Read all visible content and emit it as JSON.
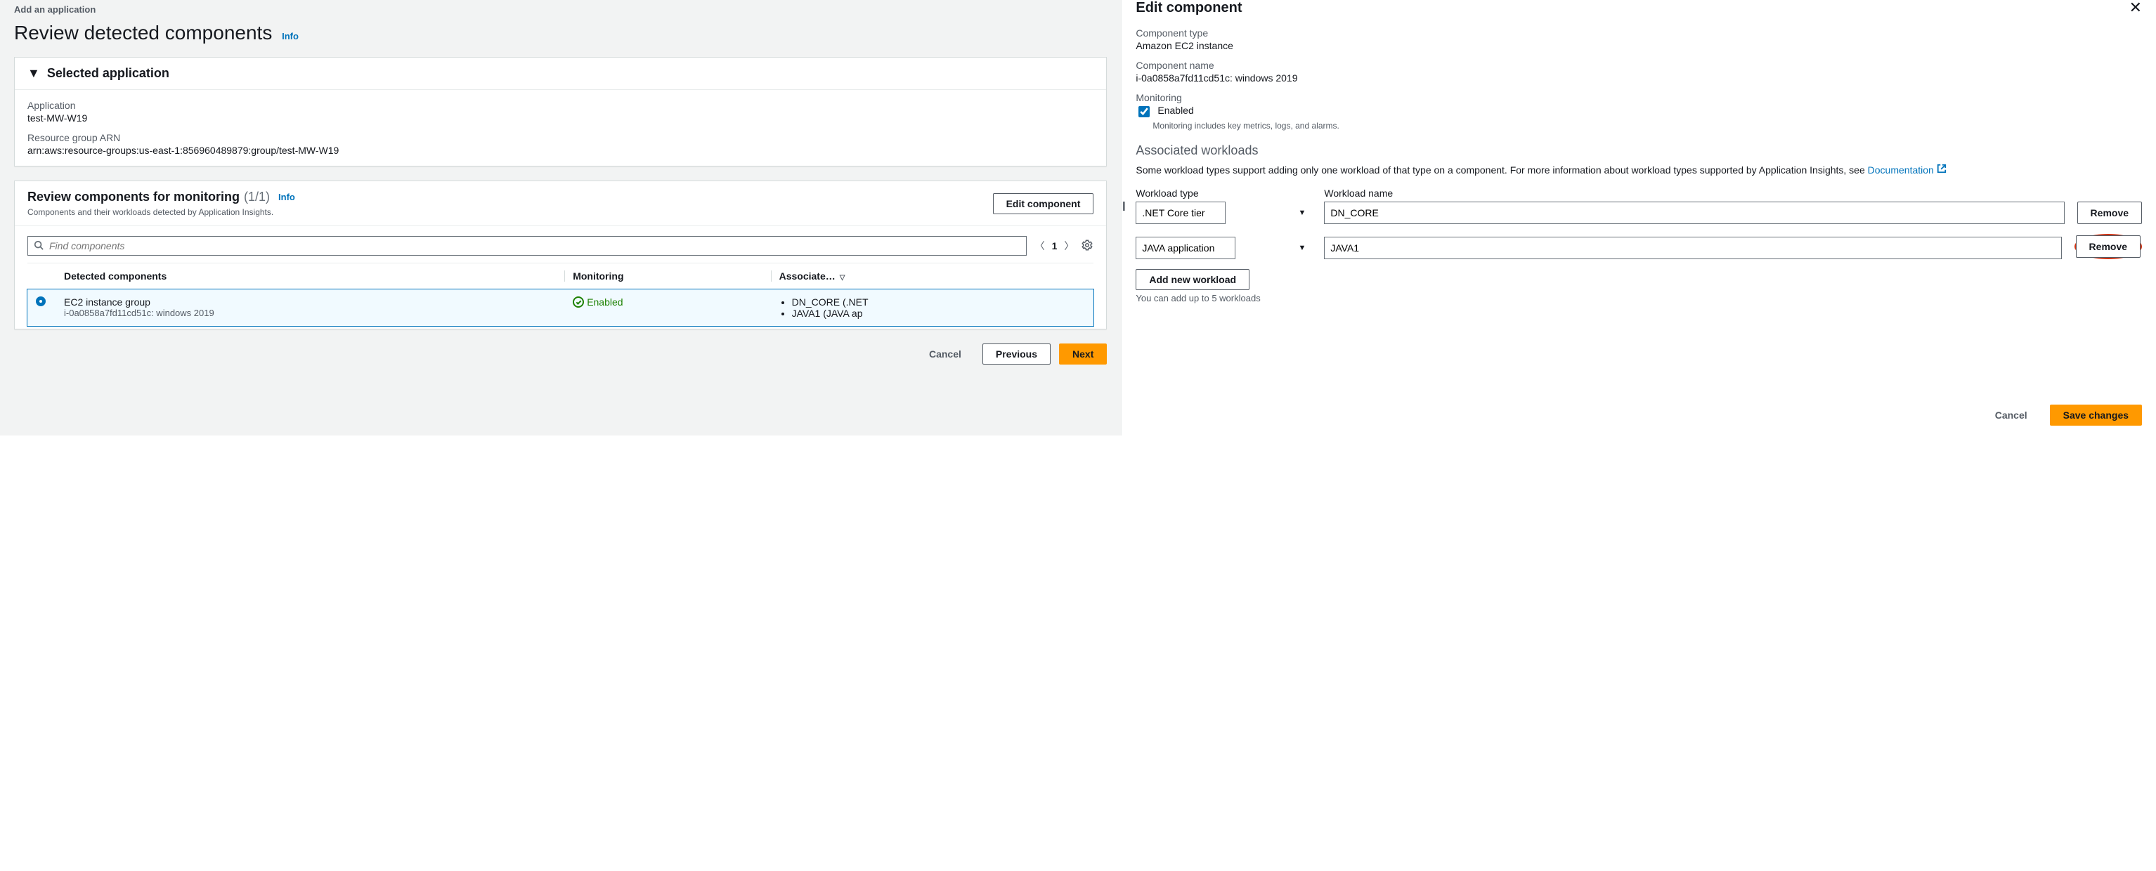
{
  "left": {
    "breadcrumb": "Add an application",
    "page_title": "Review detected components",
    "info": "Info",
    "selected_app": {
      "title": "Selected application",
      "application_label": "Application",
      "application_value": "test-MW-W19",
      "arn_label": "Resource group ARN",
      "arn_value": "arn:aws:resource-groups:us-east-1:856960489879:group/test-MW-W19"
    },
    "review": {
      "title": "Review components for monitoring",
      "count": "(1/1)",
      "info": "Info",
      "subtitle": "Components and their workloads detected by Application Insights.",
      "edit_btn": "Edit component",
      "search_placeholder": "Find components",
      "page_num": "1",
      "columns": {
        "detected": "Detected components",
        "monitoring": "Monitoring",
        "associated": "Associate…"
      },
      "row": {
        "name": "EC2 instance group",
        "sub": "i-0a0858a7fd11cd51c: windows 2019",
        "monitoring": "Enabled",
        "assoc": [
          "DN_CORE (.NET",
          "JAVA1 (JAVA ap"
        ]
      }
    },
    "footer": {
      "cancel": "Cancel",
      "previous": "Previous",
      "next": "Next"
    }
  },
  "right": {
    "title": "Edit component",
    "component_type_label": "Component type",
    "component_type_value": "Amazon EC2 instance",
    "component_name_label": "Component name",
    "component_name_value": "i-0a0858a7fd11cd51c: windows 2019",
    "monitoring_label": "Monitoring",
    "monitoring_enabled_label": "Enabled",
    "monitoring_sub": "Monitoring includes key metrics, logs, and alarms.",
    "associated_title": "Associated workloads",
    "associated_help_pre": "Some workload types support adding only one workload of that type on a component. For more information about workload types supported by Application Insights, see ",
    "associated_doc_link": "Documentation",
    "workload_type_label": "Workload type",
    "workload_name_label": "Workload name",
    "workloads": [
      {
        "type": ".NET Core tier",
        "name": "DN_CORE",
        "highlight_remove": false
      },
      {
        "type": "JAVA application",
        "name": "JAVA1",
        "highlight_remove": true
      }
    ],
    "remove": "Remove",
    "add_workload": "Add new workload",
    "limit_note": "You can add up to 5 workloads",
    "footer": {
      "cancel": "Cancel",
      "save": "Save changes"
    }
  }
}
